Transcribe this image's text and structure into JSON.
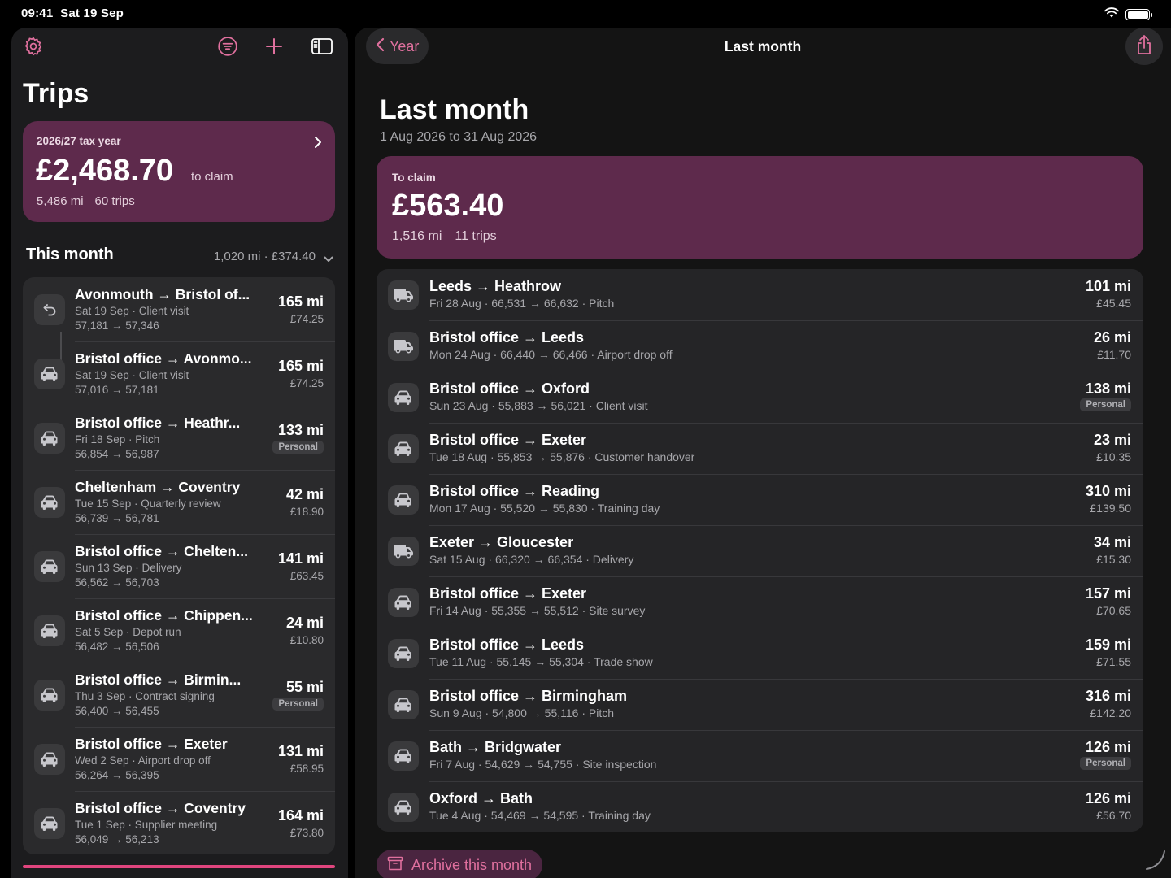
{
  "status": {
    "time": "09:41",
    "date": "Sat 19 Sep"
  },
  "colors": {
    "accent": "#e0709e",
    "card": "#5e2a4c",
    "background": "#000000"
  },
  "sidebar": {
    "title": "Trips",
    "toolbar_icons": [
      "gear-icon",
      "filter-icon",
      "plus-icon",
      "sidebar-icon"
    ],
    "tax_card": {
      "label": "2026/27 tax year",
      "amount": "£2,468.70",
      "suffix": "to claim",
      "miles": "5,486 mi",
      "trips": "60 trips"
    },
    "section": {
      "title": "This month",
      "summary": "1,020 mi · £374.40"
    },
    "trips": [
      {
        "route": "Avonmouth → Bristol of...",
        "meta": "Sat 19 Sep · Client visit",
        "odo": "57,181 → 57,346",
        "dist": "165 mi",
        "amount": "£74.25",
        "icon": "return-icon"
      },
      {
        "route": "Bristol office → Avonmo...",
        "meta": "Sat 19 Sep · Client visit",
        "odo": "57,016 → 57,181",
        "dist": "165 mi",
        "amount": "£74.25",
        "icon": "car-icon"
      },
      {
        "route": "Bristol office → Heathr...",
        "meta": "Fri 18 Sep · Pitch",
        "odo": "56,854 → 56,987",
        "dist": "133 mi",
        "badge": "Personal",
        "icon": "car-icon"
      },
      {
        "route": "Cheltenham → Coventry",
        "meta": "Tue 15 Sep · Quarterly review",
        "odo": "56,739 → 56,781",
        "dist": "42 mi",
        "amount": "£18.90",
        "icon": "car-icon"
      },
      {
        "route": "Bristol office → Chelten...",
        "meta": "Sun 13 Sep · Delivery",
        "odo": "56,562 → 56,703",
        "dist": "141 mi",
        "amount": "£63.45",
        "icon": "car-icon"
      },
      {
        "route": "Bristol office → Chippen...",
        "meta": "Sat 5 Sep · Depot run",
        "odo": "56,482 → 56,506",
        "dist": "24 mi",
        "amount": "£10.80",
        "icon": "car-icon"
      },
      {
        "route": "Bristol office → Birmin...",
        "meta": "Thu 3 Sep · Contract signing",
        "odo": "56,400 → 56,455",
        "dist": "55 mi",
        "badge": "Personal",
        "icon": "car-icon"
      },
      {
        "route": "Bristol office → Exeter",
        "meta": "Wed 2 Sep · Airport drop off",
        "odo": "56,264 → 56,395",
        "dist": "131 mi",
        "amount": "£58.95",
        "icon": "car-icon"
      },
      {
        "route": "Bristol office → Coventry",
        "meta": "Tue 1 Sep · Supplier meeting",
        "odo": "56,049 → 56,213",
        "dist": "164 mi",
        "amount": "£73.80",
        "icon": "car-icon"
      }
    ]
  },
  "detail": {
    "back_label": "Year",
    "nav_title": "Last month",
    "title": "Last month",
    "subtitle": "1 Aug 2026 to 31 Aug 2026",
    "claim": {
      "label": "To claim",
      "amount": "£563.40",
      "miles": "1,516 mi",
      "trips": "11 trips"
    },
    "trips": [
      {
        "route": "Leeds → Heathrow",
        "meta": "Fri 28 Aug · 66,531 → 66,632 · Pitch",
        "dist": "101 mi",
        "amount": "£45.45",
        "icon": "van-icon"
      },
      {
        "route": "Bristol office → Leeds",
        "meta": "Mon 24 Aug · 66,440 → 66,466 · Airport drop off",
        "dist": "26 mi",
        "amount": "£11.70",
        "icon": "van-icon"
      },
      {
        "route": "Bristol office → Oxford",
        "meta": "Sun 23 Aug · 55,883 → 56,021 · Client visit",
        "dist": "138 mi",
        "badge": "Personal",
        "icon": "car-icon"
      },
      {
        "route": "Bristol office → Exeter",
        "meta": "Tue 18 Aug · 55,853 → 55,876 · Customer handover",
        "dist": "23 mi",
        "amount": "£10.35",
        "icon": "car-icon"
      },
      {
        "route": "Bristol office → Reading",
        "meta": "Mon 17 Aug · 55,520 → 55,830 · Training day",
        "dist": "310 mi",
        "amount": "£139.50",
        "icon": "car-icon"
      },
      {
        "route": "Exeter → Gloucester",
        "meta": "Sat 15 Aug · 66,320 → 66,354 · Delivery",
        "dist": "34 mi",
        "amount": "£15.30",
        "icon": "van-icon"
      },
      {
        "route": "Bristol office → Exeter",
        "meta": "Fri 14 Aug · 55,355 → 55,512 · Site survey",
        "dist": "157 mi",
        "amount": "£70.65",
        "icon": "car-icon"
      },
      {
        "route": "Bristol office → Leeds",
        "meta": "Tue 11 Aug · 55,145 → 55,304 · Trade show",
        "dist": "159 mi",
        "amount": "£71.55",
        "icon": "car-icon"
      },
      {
        "route": "Bristol office → Birmingham",
        "meta": "Sun 9 Aug · 54,800 → 55,116 · Pitch",
        "dist": "316 mi",
        "amount": "£142.20",
        "icon": "car-icon"
      },
      {
        "route": "Bath → Bridgwater",
        "meta": "Fri 7 Aug · 54,629 → 54,755 · Site inspection",
        "dist": "126 mi",
        "badge": "Personal",
        "icon": "car-icon"
      },
      {
        "route": "Oxford → Bath",
        "meta": "Tue 4 Aug · 54,469 → 54,595 · Training day",
        "dist": "126 mi",
        "amount": "£56.70",
        "icon": "car-icon"
      }
    ],
    "archive_label": "Archive this month"
  }
}
